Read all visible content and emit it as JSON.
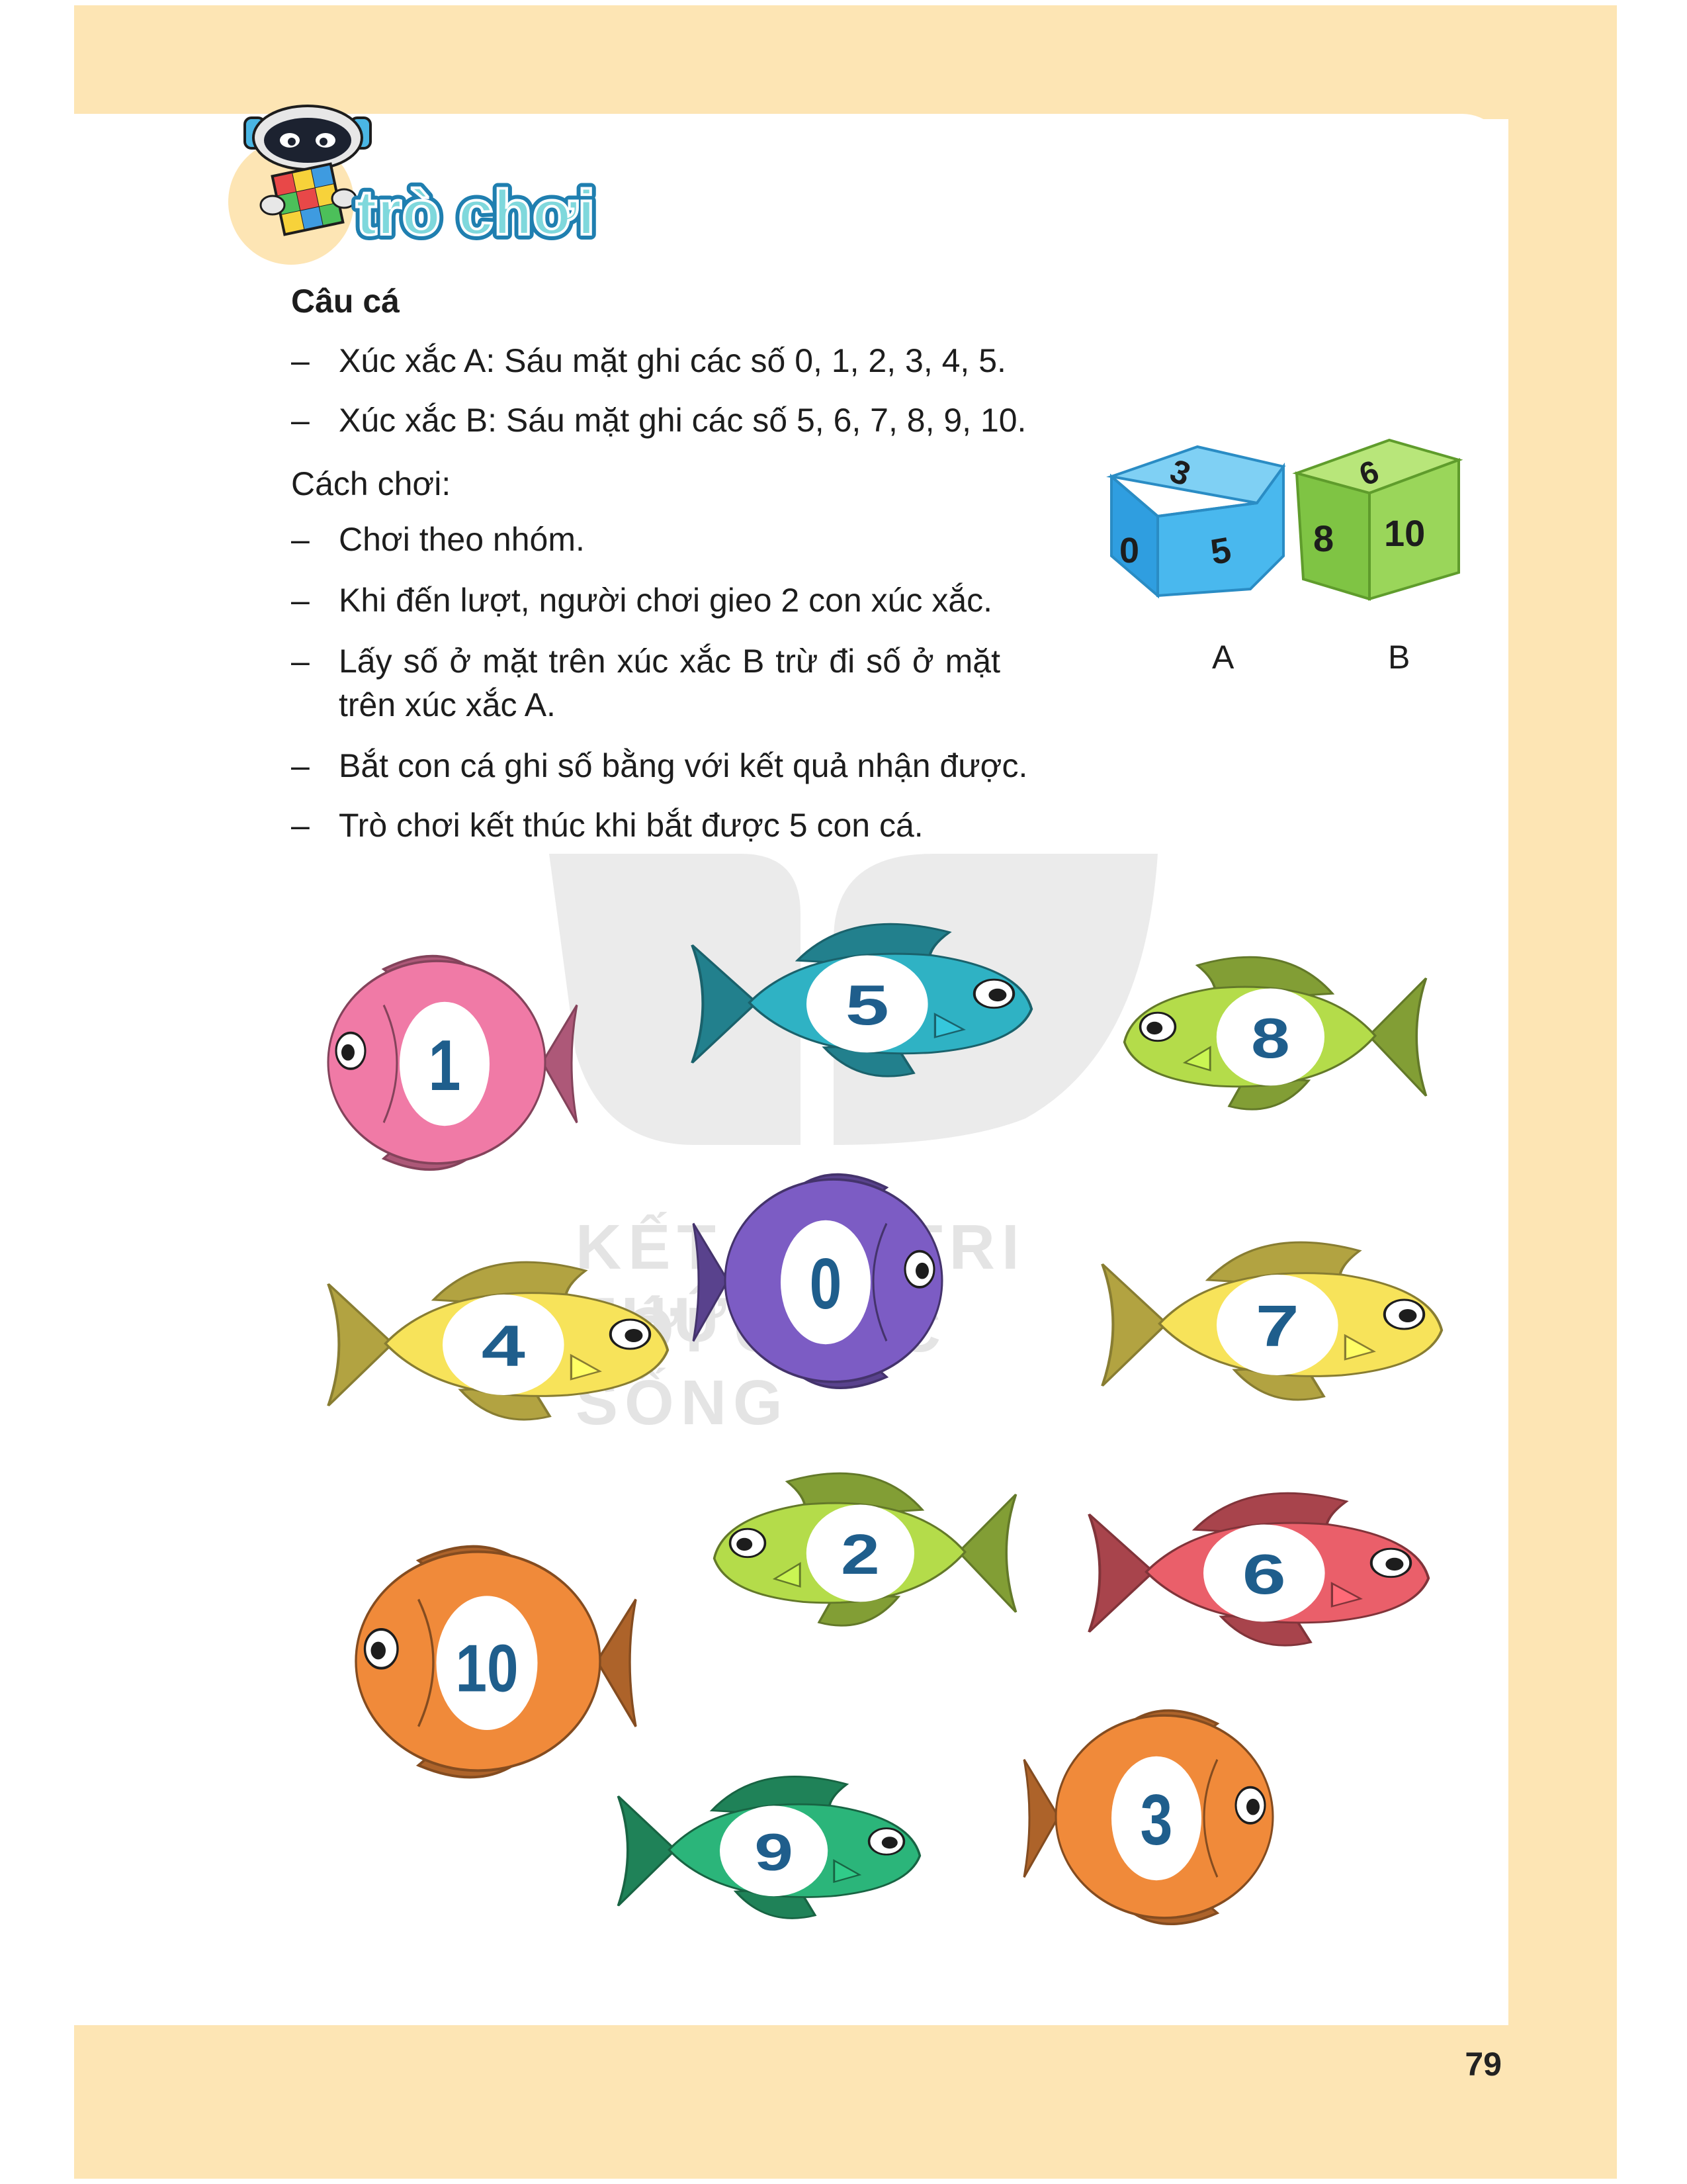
{
  "header": {
    "title": "trò chơi"
  },
  "game": {
    "title": "Câu cá",
    "dice_rules": [
      "Xúc xắc A: Sáu mặt ghi các số 0, 1, 2, 3, 4, 5.",
      "Xúc xắc B: Sáu mặt ghi các số 5, 6, 7, 8, 9, 10."
    ],
    "how_to_play_label": "Cách chơi:",
    "steps": [
      "Chơi theo nhóm.",
      "Khi đến lượt, người chơi gieo 2 con xúc xắc.",
      "Lấy số ở mặt trên xúc xắc B trừ đi số ở mặt trên xúc xắc A.",
      "Bắt con cá ghi số bằng với kết quả nhận được.",
      "Trò chơi kết thúc khi bắt được 5 con cá."
    ],
    "dash": "–"
  },
  "dice": [
    {
      "label": "A",
      "faces": [
        "3",
        "0",
        "5"
      ],
      "color": "#3fb0e8"
    },
    {
      "label": "B",
      "faces": [
        "6",
        "8",
        "10"
      ],
      "color": "#8fcd4a"
    }
  ],
  "fish": [
    {
      "number": "1",
      "color": "#f07aa6"
    },
    {
      "number": "5",
      "color": "#2fb2c4"
    },
    {
      "number": "8",
      "color": "#b4dc4a"
    },
    {
      "number": "0",
      "color": "#7c5cc4"
    },
    {
      "number": "4",
      "color": "#f7e35a"
    },
    {
      "number": "7",
      "color": "#f7e35a"
    },
    {
      "number": "2",
      "color": "#b4dc4a"
    },
    {
      "number": "6",
      "color": "#ea5f6a"
    },
    {
      "number": "10",
      "color": "#f08a3a"
    },
    {
      "number": "9",
      "color": "#2bb57a"
    },
    {
      "number": "3",
      "color": "#f08a3a"
    }
  ],
  "watermark": {
    "line1": "KẾT NỐI TRI THỨC",
    "line2": "VỚI CUỘC SỐNG"
  },
  "page_number": "79"
}
